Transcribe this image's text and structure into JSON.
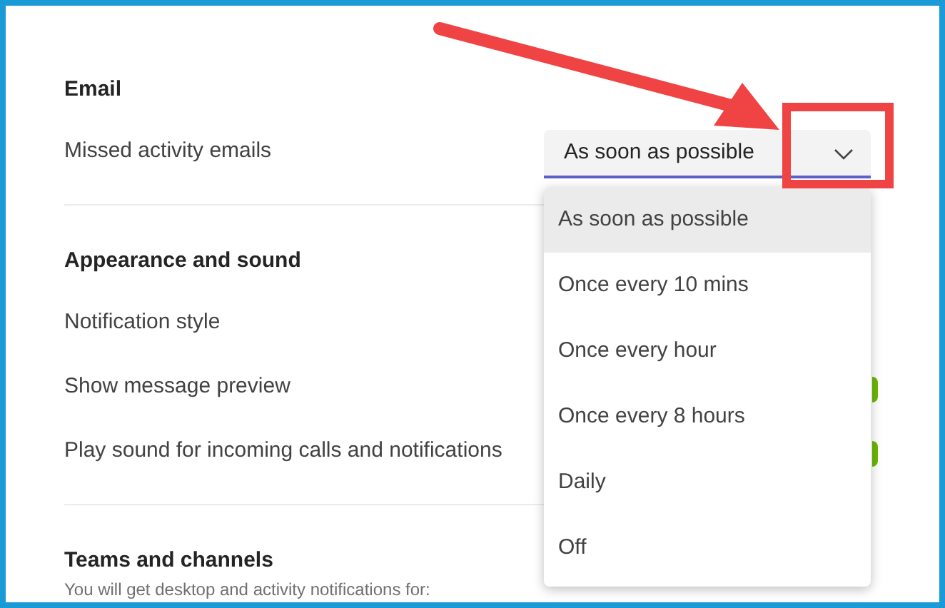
{
  "sections": [
    {
      "title": "Email",
      "rows": [
        {
          "label": "Missed activity emails",
          "kind": "select"
        }
      ]
    },
    {
      "title": "Appearance and sound",
      "rows": [
        {
          "label": "Notification style",
          "kind": "plain"
        },
        {
          "label": "Show message preview",
          "kind": "toggle",
          "on": true
        },
        {
          "label": "Play sound for incoming calls and notifications",
          "kind": "toggle",
          "on": true
        }
      ]
    },
    {
      "title": "Teams and channels",
      "note": "You will get desktop and activity notifications for:"
    }
  ],
  "select": {
    "value": "As soon as possible",
    "options": [
      {
        "label": "As soon as possible",
        "selected": true
      },
      {
        "label": "Once every 10 mins",
        "selected": false
      },
      {
        "label": "Once every hour",
        "selected": false
      },
      {
        "label": "Once every 8 hours",
        "selected": false
      },
      {
        "label": "Daily",
        "selected": false
      },
      {
        "label": "Off",
        "selected": false
      }
    ]
  }
}
